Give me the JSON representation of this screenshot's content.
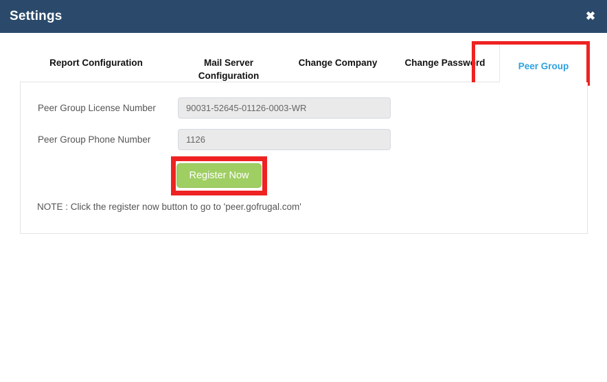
{
  "window": {
    "title": "Settings",
    "close_icon": "close-icon",
    "close_glyph": "✖",
    "header_color": "#2b4a6b"
  },
  "tabs": {
    "active_index": 4,
    "active_color": "#2ca1e0",
    "items": [
      {
        "label": "Report Configuration"
      },
      {
        "label": "Mail Server Configuration"
      },
      {
        "label": "Change Company"
      },
      {
        "label": "Change Password"
      },
      {
        "label": "Peer Group"
      }
    ]
  },
  "form": {
    "fields": [
      {
        "label": "Peer Group License Number",
        "value": "90031-52645-01126-0003-WR",
        "placeholder": ""
      },
      {
        "label": "Peer Group Phone Number",
        "value": "1126",
        "placeholder": ""
      }
    ],
    "register_button": {
      "label": "Register Now",
      "color": "#9fce63"
    },
    "note": "NOTE : Click the register now button to go to 'peer.gofrugal.com'"
  },
  "annotations": {
    "color": "#ee2222",
    "highlights": [
      {
        "target": "peer-group-tab"
      },
      {
        "target": "register-now-button"
      }
    ]
  }
}
